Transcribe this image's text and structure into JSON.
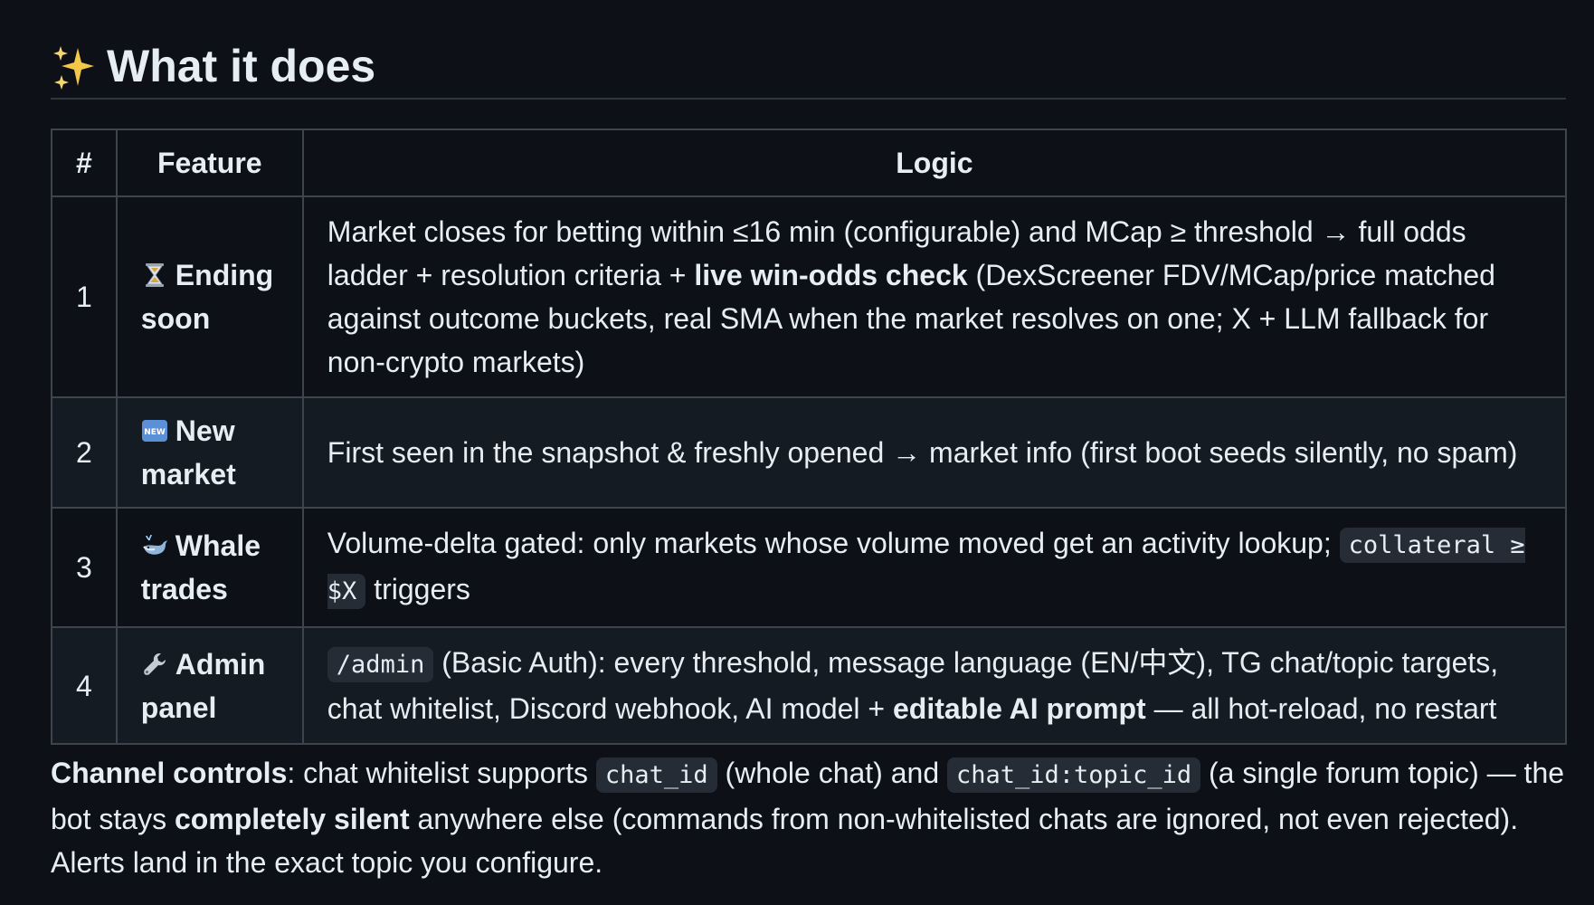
{
  "heading": {
    "icon": "sparkles-icon",
    "title": "What it does"
  },
  "table": {
    "headers": [
      "#",
      "Feature",
      "Logic"
    ],
    "rows": [
      {
        "num": "1",
        "icon": "hourglass-icon",
        "feature": "Ending soon",
        "logic": {
          "part1": "Market closes for betting within ≤16 min (configurable) and MCap ≥ threshold → full odds ladder + resolution criteria + ",
          "bold1": "live win-odds check",
          "part2": " (DexScreener FDV/MCap/price matched against outcome buckets, real SMA when the market resolves on one; X + LLM fallback for non-crypto markets)"
        }
      },
      {
        "num": "2",
        "icon": "new-badge-icon",
        "icon_text": "NEW",
        "feature": "New market",
        "logic": {
          "part1": "First seen in the snapshot & freshly opened → market info (first boot seeds silently, no spam)"
        }
      },
      {
        "num": "3",
        "icon": "whale-icon",
        "feature": "Whale trades",
        "logic": {
          "part1": "Volume-delta gated: only markets whose volume moved get an activity lookup; ",
          "code1": "collateral ≥ $X",
          "part2": " triggers"
        }
      },
      {
        "num": "4",
        "icon": "wrench-icon",
        "feature": "Admin panel",
        "logic": {
          "code1": "/admin",
          "part1": " (Basic Auth): every threshold, message language (EN/中文), TG chat/topic targets, chat whitelist, Discord webhook, AI model + ",
          "bold1": "editable AI prompt",
          "part2": " — all hot-reload, no restart"
        }
      }
    ]
  },
  "channel_note": {
    "bold1": "Channel controls",
    "text1": ": chat whitelist supports ",
    "code1": "chat_id",
    "text2": " (whole chat) and ",
    "code2": "chat_id:topic_id",
    "text3": " (a single forum topic) — the bot stays ",
    "bold2": "completely silent",
    "text4": " anywhere else (commands from non-whitelisted chats are ignored, not even rejected). Alerts land in the exact topic you configure."
  }
}
